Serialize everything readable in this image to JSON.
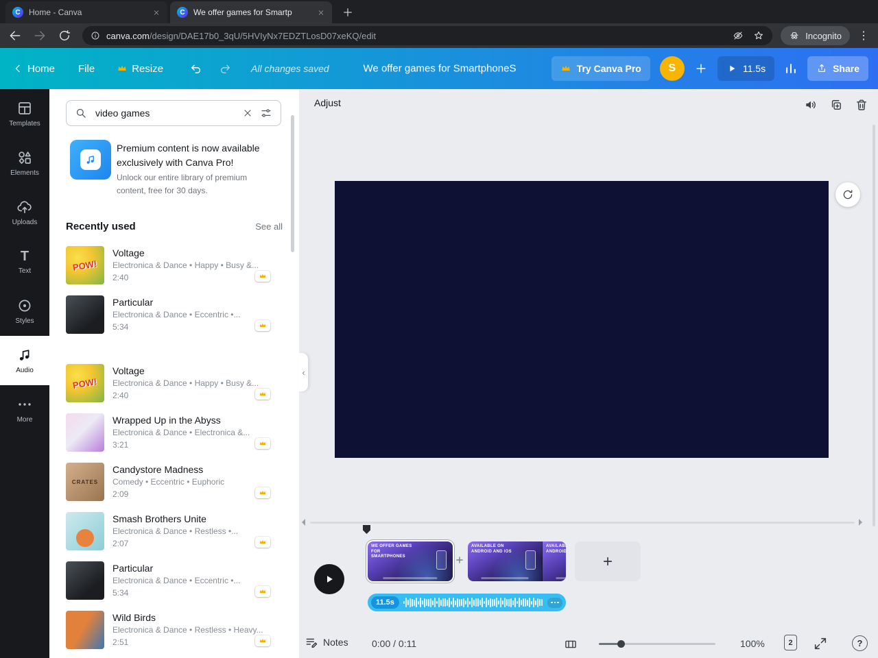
{
  "colors": {
    "header-teal": "#00b4c5",
    "header-blue": "#2e6ff2",
    "audio-blue": "#38bdf3",
    "avatar-yellow": "#f7b500",
    "crown-gold": "#f2b200",
    "canvas-navy": "#0e1034",
    "promo-blue": "#1e86ee"
  },
  "browser": {
    "favicon_letter": "C",
    "tabs": [
      {
        "title": "Home - Canva"
      },
      {
        "title": "We offer games for Smartp"
      }
    ],
    "url": {
      "host": "canva.com",
      "path": "/design/DAE17b0_3qU/5HVIyNx7EDZTLosD07xeKQ/edit"
    },
    "incognito_label": "Incognito"
  },
  "header": {
    "home_label": "Home",
    "file_label": "File",
    "resize_label": "Resize",
    "saved_status": "All changes saved",
    "design_title": "We offer games for SmartphoneS",
    "try_pro_label": "Try Canva Pro",
    "avatar_initial": "S",
    "play_duration": "11.5s",
    "share_label": "Share"
  },
  "rail": {
    "items": [
      {
        "label": "Templates"
      },
      {
        "label": "Elements"
      },
      {
        "label": "Uploads"
      },
      {
        "label": "Text"
      },
      {
        "label": "Styles"
      },
      {
        "label": "Audio"
      },
      {
        "label": "More"
      }
    ]
  },
  "audio_panel": {
    "search_value": "video games",
    "promo_title": "Premium content is now available exclusively with Canva Pro!",
    "promo_subtitle": "Unlock our entire library of premium content, free for 30 days.",
    "section_title": "Recently used",
    "see_all_label": "See all",
    "tracks": [
      {
        "title": "Voltage",
        "meta": "Electronica & Dance • Happy • Busy &...",
        "duration": "2:40",
        "art_text": "POW!"
      },
      {
        "title": "Particular",
        "meta": "Electronica & Dance • Eccentric •...",
        "duration": "5:34"
      },
      {
        "title": "Voltage",
        "meta": "Electronica & Dance • Happy • Busy &...",
        "duration": "2:40",
        "art_text": "POW!"
      },
      {
        "title": "Wrapped Up in the Abyss",
        "meta": "Electronica & Dance • Electronica &...",
        "duration": "3:21"
      },
      {
        "title": "Candystore Madness",
        "meta": "Comedy • Eccentric • Euphoric",
        "duration": "2:09",
        "art_text": "CRATES"
      },
      {
        "title": "Smash Brothers Unite",
        "meta": "Electronica & Dance • Restless •...",
        "duration": "2:07"
      },
      {
        "title": "Particular",
        "meta": "Electronica & Dance • Eccentric •...",
        "duration": "5:34"
      },
      {
        "title": "Wild Birds",
        "meta": "Electronica & Dance • Restless • Heavy...",
        "duration": "2:51"
      }
    ]
  },
  "editor": {
    "adjust_label": "Adjust",
    "timeline": {
      "clip1_caption": "WE OFFER GAMES FOR SMARTPHONES",
      "clip2_caption": "AVAILABLE ON ANDROID AND IOS",
      "audio_chip": "11.5s"
    },
    "statusbar": {
      "notes_label": "Notes",
      "time_display": "0:00 / 0:11",
      "zoom_display": "100%",
      "page_indicator": "2"
    }
  }
}
